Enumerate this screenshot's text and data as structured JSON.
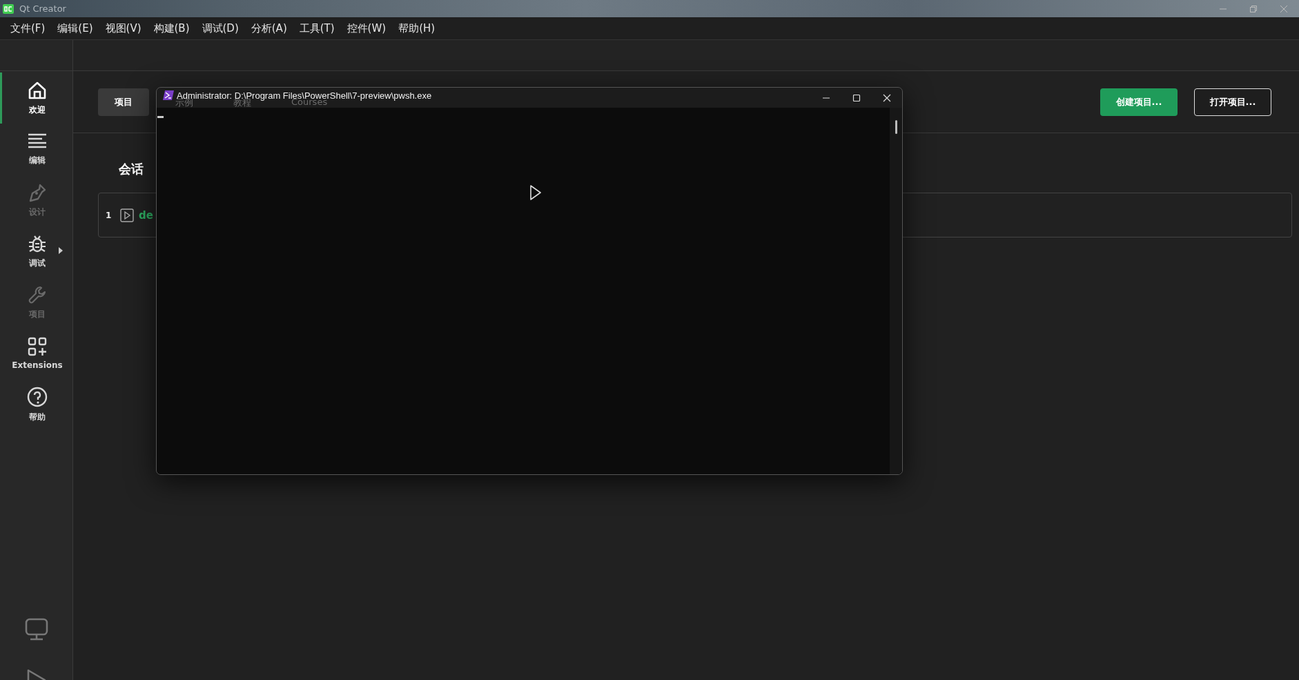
{
  "window": {
    "title": "Qt Creator"
  },
  "menu": [
    "文件(F)",
    "编辑(E)",
    "视图(V)",
    "构建(B)",
    "调试(D)",
    "分析(A)",
    "工具(T)",
    "控件(W)",
    "帮助(H)"
  ],
  "sidebar": {
    "items": [
      {
        "label": "欢迎",
        "selected": true,
        "disabled": false,
        "submenu": false
      },
      {
        "label": "编辑",
        "selected": false,
        "disabled": false,
        "submenu": false
      },
      {
        "label": "设计",
        "selected": false,
        "disabled": true,
        "submenu": false
      },
      {
        "label": "调试",
        "selected": false,
        "disabled": false,
        "submenu": true
      },
      {
        "label": "项目",
        "selected": false,
        "disabled": true,
        "submenu": false
      },
      {
        "label": "Extensions",
        "selected": false,
        "disabled": false,
        "submenu": false
      },
      {
        "label": "帮助",
        "selected": false,
        "disabled": false,
        "submenu": false
      }
    ]
  },
  "tabs": [
    {
      "label": "项目",
      "selected": true
    },
    {
      "label": "示例",
      "selected": false
    },
    {
      "label": "教程",
      "selected": false
    },
    {
      "label": "Courses",
      "selected": false
    }
  ],
  "buttons": [
    {
      "label": "创建项目...",
      "kind": "primary"
    },
    {
      "label": "打开项目...",
      "kind": "outline"
    }
  ],
  "sessions": {
    "title": "会话",
    "items": [
      {
        "number": "1",
        "name": "de"
      }
    ]
  },
  "terminal": {
    "title": "Administrator: D:\\Program Files\\PowerShell\\7-preview\\pwsh.exe"
  }
}
